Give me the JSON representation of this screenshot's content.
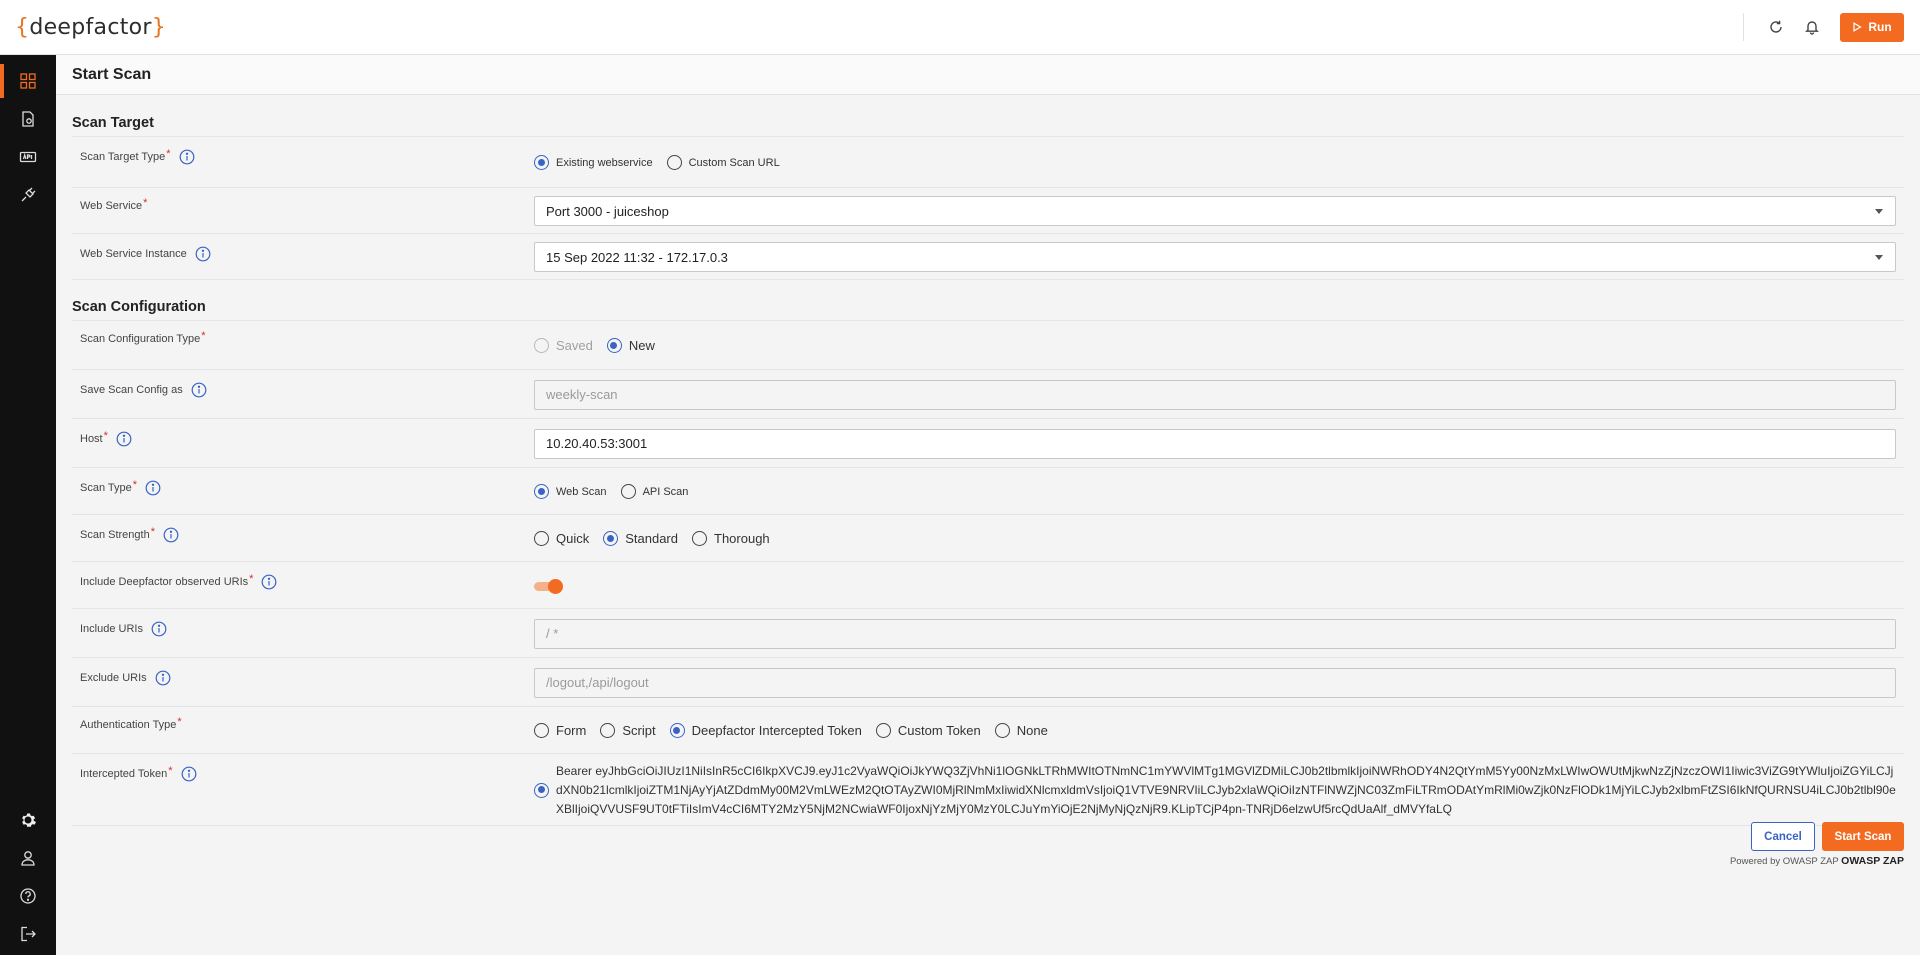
{
  "app": {
    "logo_open": "{",
    "logo_text": "deepfactor",
    "logo_close": "}",
    "run_label": "Run"
  },
  "sidebar": {
    "items": [
      {
        "icon": "dashboard-icon",
        "active": true
      },
      {
        "icon": "applications-icon",
        "active": false
      },
      {
        "icon": "api-icon",
        "active": false
      },
      {
        "icon": "integrations-icon",
        "active": false
      }
    ],
    "bottom_items": [
      {
        "icon": "gear-icon"
      },
      {
        "icon": "user-icon"
      },
      {
        "icon": "help-icon"
      },
      {
        "icon": "logout-icon"
      }
    ]
  },
  "page": {
    "title": "Start Scan"
  },
  "scan_target": {
    "section_title": "Scan Target",
    "target_type": {
      "label": "Scan Target Type",
      "options": [
        "Existing webservice",
        "Custom Scan URL"
      ],
      "selected": "Existing webservice"
    },
    "web_service": {
      "label": "Web Service",
      "value": "Port 3000 - juiceshop"
    },
    "web_service_instance": {
      "label": "Web Service Instance",
      "value": "15 Sep 2022 11:32 - 172.17.0.3"
    }
  },
  "scan_config": {
    "section_title": "Scan Configuration",
    "config_type": {
      "label": "Scan Configuration Type",
      "options": [
        "Saved",
        "New"
      ],
      "selected": "New"
    },
    "save_as": {
      "label": "Save Scan Config as",
      "placeholder": "weekly-scan"
    },
    "host": {
      "label": "Host",
      "value": "10.20.40.53:3001"
    },
    "scan_type": {
      "label": "Scan Type",
      "options": [
        "Web Scan",
        "API Scan"
      ],
      "selected": "Web Scan"
    },
    "scan_strength": {
      "label": "Scan Strength",
      "options": [
        "Quick",
        "Standard",
        "Thorough"
      ],
      "selected": "Standard"
    },
    "include_observed": {
      "label": "Include Deepfactor observed URIs",
      "enabled": true
    },
    "include_uris": {
      "label": "Include URIs",
      "placeholder": "/ *"
    },
    "exclude_uris": {
      "label": "Exclude URIs",
      "placeholder": "/logout,/api/logout"
    },
    "auth_type": {
      "label": "Authentication Type",
      "options": [
        "Form",
        "Script",
        "Deepfactor Intercepted Token",
        "Custom Token",
        "None"
      ],
      "selected": "Deepfactor Intercepted Token"
    },
    "intercepted_token": {
      "label": "Intercepted Token",
      "value": "Bearer eyJhbGciOiJIUzI1NiIsInR5cCI6IkpXVCJ9.eyJ1c2VyaWQiOiJkYWQ3ZjVhNi1lOGNkLTRhMWItOTNmNC1mYWVlMTg1MGVlZDMiLCJ0b2tlbmlkIjoiNWRhODY4N2QtYmM5Yy00NzMxLWIwOWUtMjkwNzZjNzczOWI1Iiwic3ViZG9tYWluIjoiZGYiLCJjdXN0b21lcmlkIjoiZTM1NjAyYjAtZDdmMy00M2VmLWEzM2QtOTAyZWI0MjRlNmMxIiwidXNlcmxldmVsIjoiQ1VTVE9NRVIiLCJyb2xlaWQiOiIzNTFlNWZjNC03ZmFiLTRmODAtYmRlMi0wZjk0NzFlODk1MjYiLCJyb2xlbmFtZSI6IkNfQURNSU4iLCJ0b2tlbl90eXBlIjoiQVVUSF9UT0tFTiIsImV4cCI6MTY2MzY5NjM2NCwiaWF0IjoxNjYzMjY0MzY0LCJuYmYiOjE2NjMyNjQzNjR9.KLipTCjP4pn-TNRjD6elzwUf5rcQdUaAlf_dMVYfaLQ"
    }
  },
  "actions": {
    "cancel_label": "Cancel",
    "start_label": "Start Scan",
    "powered_by": "Powered by OWASP ZAP",
    "powered_brand": "OWASP ZAP"
  },
  "colors": {
    "accent": "#f26b21",
    "radio_selected": "#3a63c4",
    "sidebar_bg": "#111111",
    "required": "#d32f2f"
  }
}
